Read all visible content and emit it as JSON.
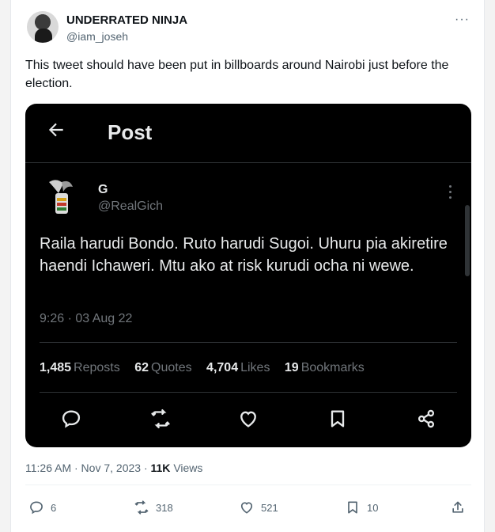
{
  "author": {
    "display_name": "UNDERRATED NINJA",
    "handle": "@iam_joseh"
  },
  "tweet": {
    "text": "This tweet should have been put in billboards around Nairobi just before the election.",
    "meta_time": "11:26 AM · Nov 7, 2023 ·",
    "views_count": "11K",
    "views_label": "Views"
  },
  "embed": {
    "header_title": "Post",
    "name": "G",
    "handle": "@RealGich",
    "text": "Raila harudi Bondo. Ruto harudi Sugoi. Uhuru pia akiretire haendi Ichaweri. Mtu ako at risk kurudi ocha ni wewe.",
    "timestamp": "9:26 · 03 Aug 22",
    "stats": [
      {
        "value": "1,485",
        "label": "Reposts"
      },
      {
        "value": "62",
        "label": "Quotes"
      },
      {
        "value": "4,704",
        "label": "Likes"
      },
      {
        "value": "19",
        "label": "Bookmarks"
      }
    ],
    "icons": [
      "reply-icon",
      "repost-icon",
      "like-icon",
      "bookmark-icon",
      "share-icon"
    ]
  },
  "actions": {
    "replies": "6",
    "reposts": "318",
    "likes": "521",
    "bookmarks": "10"
  },
  "colors": {
    "embed_bg": "#000000",
    "embed_text": "#e7e9ea",
    "muted": "#536471"
  }
}
